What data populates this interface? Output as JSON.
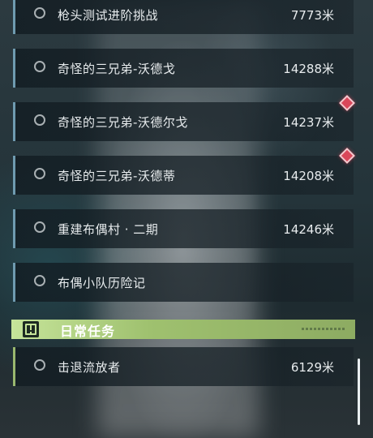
{
  "main_quests": [
    {
      "name": "枪头测试进阶挑战",
      "distance": "7773米",
      "alert": false
    },
    {
      "name": "奇怪的三兄弟-沃德戈",
      "distance": "14288米",
      "alert": false
    },
    {
      "name": "奇怪的三兄弟-沃德尔戈",
      "distance": "14237米",
      "alert": true
    },
    {
      "name": "奇怪的三兄弟-沃德蒂",
      "distance": "14208米",
      "alert": true
    },
    {
      "name": "重建布偶村 · 二期",
      "distance": "14246米",
      "alert": false
    },
    {
      "name": "布偶小队历险记",
      "distance": "",
      "alert": false
    }
  ],
  "daily_section": {
    "title": "日常任务",
    "icon": "exclamation-icon",
    "accent": "#9fc16f",
    "quests": [
      {
        "name": "击退流放者",
        "distance": "6129米",
        "alert": false
      }
    ]
  },
  "colors": {
    "main_accent": "#6f9bb0",
    "daily_accent": "#9ab86f",
    "alert": "#d9475a"
  }
}
